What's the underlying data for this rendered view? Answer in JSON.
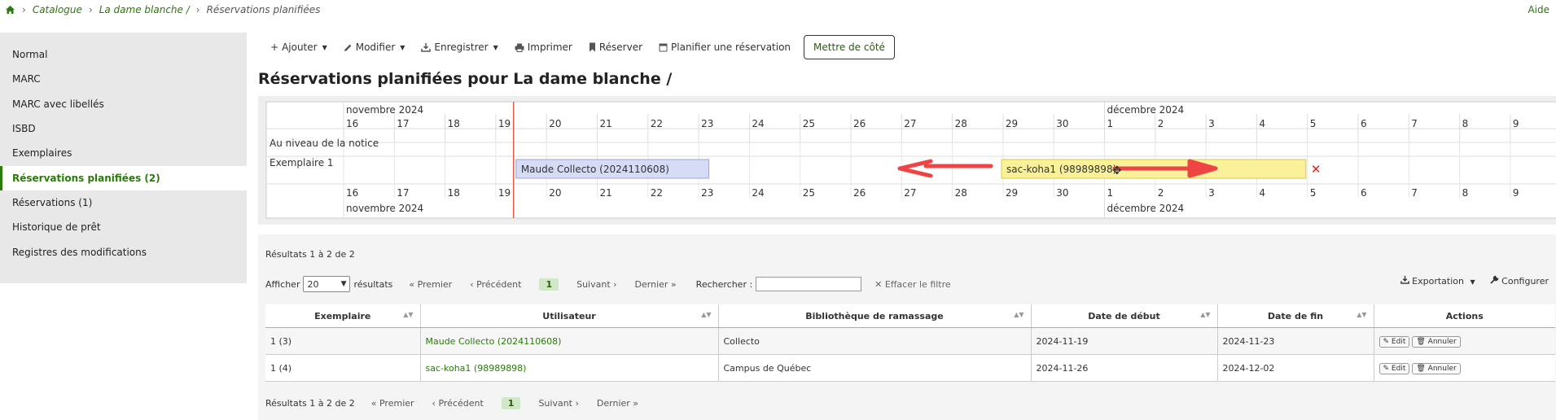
{
  "breadcrumb": {
    "home_icon": "home-icon",
    "items": [
      "Catalogue",
      "La dame blanche /"
    ],
    "current": "Réservations planifiées"
  },
  "help_label": "Aide",
  "sidebar": {
    "items": [
      {
        "label": "Normal",
        "active": false
      },
      {
        "label": "MARC",
        "active": false
      },
      {
        "label": "MARC avec libellés",
        "active": false
      },
      {
        "label": "ISBD",
        "active": false
      },
      {
        "label": "Exemplaires",
        "active": false
      },
      {
        "label": "Réservations planifiées (2)",
        "active": true
      },
      {
        "label": "Réservations (1)",
        "active": false
      },
      {
        "label": "Historique de prêt",
        "active": false
      },
      {
        "label": "Registres des modifications",
        "active": false
      }
    ]
  },
  "toolbar": {
    "add": "Ajouter",
    "edit": "Modifier",
    "save": "Enregistrer",
    "print": "Imprimer",
    "reserve": "Réserver",
    "schedule": "Planifier une réservation",
    "set_aside": "Mettre de côté"
  },
  "page_title": "Réservations planifiées pour La dame blanche /",
  "timeline": {
    "months": [
      "novembre 2024",
      "décembre 2024"
    ],
    "days": [
      "16",
      "17",
      "18",
      "19",
      "20",
      "21",
      "22",
      "23",
      "24",
      "25",
      "26",
      "27",
      "28",
      "29",
      "30",
      "1",
      "2",
      "3",
      "4",
      "5",
      "6",
      "7",
      "8",
      "9"
    ],
    "first_month_days": 15,
    "today_index": 3.35,
    "rows": [
      "Au niveau de la notice",
      "Exemplaire 1"
    ],
    "bookings": [
      {
        "label": "Maude Collecto (2024110608)",
        "start_index": 3.4,
        "end_index": 7.2,
        "color": "#d6dcf5",
        "border": "#9aa6d8"
      },
      {
        "label": "sac-koha1 (98989898)",
        "start_index": 12.97,
        "end_index": 18.97,
        "color": "#faf19a",
        "border": "#d8c94a"
      }
    ],
    "arrows_color": "#ef4444",
    "today_color": "#e05a4a"
  },
  "results": {
    "info": "Résultats 1 à 2 de 2",
    "show": "Afficher",
    "page_size": "20",
    "results_word": "résultats",
    "first": "Premier",
    "previous": "Précédent",
    "page": "1",
    "next": "Suivant",
    "last": "Dernier",
    "search_label": "Rechercher :",
    "clear_filter": "Effacer le filtre",
    "export": "Exportation",
    "configure": "Configurer",
    "columns": [
      "Exemplaire",
      "Utilisateur",
      "Bibliothèque de ramassage",
      "Date de début",
      "Date de fin",
      "Actions"
    ],
    "rows": [
      {
        "item": "1 (3)",
        "patron": "Maude Collecto (2024110608)",
        "library": "Collecto",
        "start": "2024-11-19",
        "end": "2024-11-23"
      },
      {
        "item": "1 (4)",
        "patron": "sac-koha1 (98989898)",
        "library": "Campus de Québec",
        "start": "2024-11-26",
        "end": "2024-12-02"
      }
    ],
    "edit_label": "Edit",
    "cancel_label": "Annuler"
  }
}
